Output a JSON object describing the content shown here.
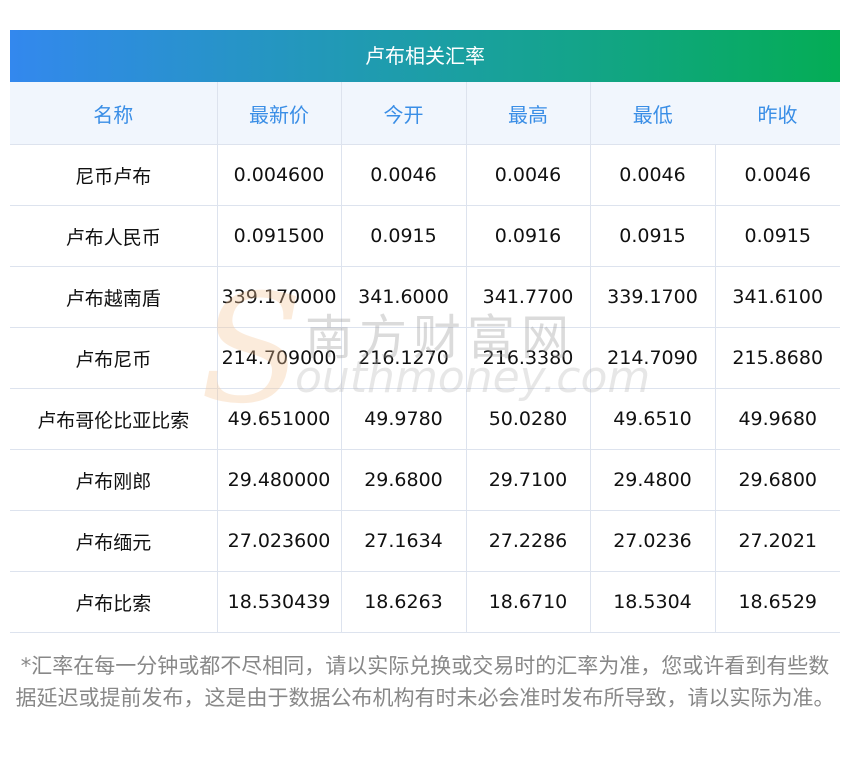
{
  "title": "卢布相关汇率",
  "columns": [
    "名称",
    "最新价",
    "今开",
    "最高",
    "最低",
    "昨收"
  ],
  "rows": [
    [
      "尼币卢布",
      "0.004600",
      "0.0046",
      "0.0046",
      "0.0046",
      "0.0046"
    ],
    [
      "卢布人民币",
      "0.091500",
      "0.0915",
      "0.0916",
      "0.0915",
      "0.0915"
    ],
    [
      "卢布越南盾",
      "339.170000",
      "341.6000",
      "341.7700",
      "339.1700",
      "341.6100"
    ],
    [
      "卢布尼币",
      "214.709000",
      "216.1270",
      "216.3380",
      "214.7090",
      "215.8680"
    ],
    [
      "卢布哥伦比亚比索",
      "49.651000",
      "49.9780",
      "50.0280",
      "49.6510",
      "49.9680"
    ],
    [
      "卢布刚郎",
      "29.480000",
      "29.6800",
      "29.7100",
      "29.4800",
      "29.6800"
    ],
    [
      "卢布缅元",
      "27.023600",
      "27.1634",
      "27.2286",
      "27.0236",
      "27.2021"
    ],
    [
      "卢布比索",
      "18.530439",
      "18.6263",
      "18.6710",
      "18.5304",
      "18.6529"
    ]
  ],
  "note": "*汇率在每一分钟或都不尽相同，请以实际兑换或交易时的汇率为准，您或许看到有些数据延迟或提前发布，这是由于数据公布机构有时未必会准时发布所导致，请以实际为准。",
  "watermark": {
    "cn": "南方财富网",
    "en": "outhmoney.com",
    "s": "S"
  }
}
